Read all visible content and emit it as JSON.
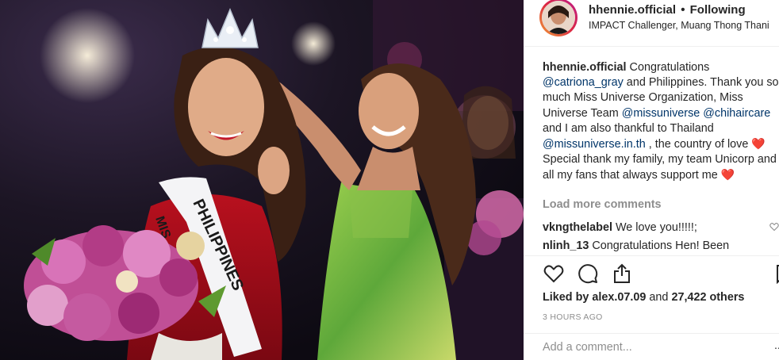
{
  "photo": {
    "description_icon": "photo-image",
    "sash_text": "PHILIPPINES",
    "sash_text_2": "MIS"
  },
  "header": {
    "username": "hhennie.official",
    "separator": "•",
    "follow_label": "Following",
    "location": "IMPACT Challenger, Muang Thong Thani"
  },
  "caption": {
    "author": "hhennie.official",
    "t1": " Congratulations ",
    "m1": "@catriona_gray",
    "t2": " and Philippines. Thank you so much Miss Universe Organization, Miss Universe Team ",
    "m2": "@missuniverse",
    "t3": " ",
    "m3": "@chihaircare",
    "t4": " and I am also thankful to Thailand ",
    "m4": "@missuniverse.in.th",
    "t5": " , the country of love ",
    "heart1": "❤️",
    "t6": " Special thank my family, my team Unicorp and all my fans that always support me ",
    "heart2": "❤️"
  },
  "load_more_label": "Load more comments",
  "comments": [
    {
      "user": "vkngthelabel",
      "text": " We love you!!!!!;"
    },
    {
      "user": "nlinh_13",
      "text": " Congratulations Hen! Been"
    }
  ],
  "actions": {
    "like_icon": "heart-outline-icon",
    "comment_icon": "speech-bubble-icon",
    "share_icon": "share-upload-icon",
    "save_icon": "bookmark-icon"
  },
  "likes": {
    "prefix": "Liked by ",
    "user": "alex.07.09",
    "middle": " and ",
    "count": "27,422 others"
  },
  "time_ago": "3 HOURS AGO",
  "add_comment": {
    "placeholder": "Add a comment...",
    "more": "..."
  },
  "colors": {
    "text": "#262626",
    "mention": "#003569",
    "muted": "#8e8e8e",
    "heart": "#ed4956",
    "border": "#efefef"
  }
}
